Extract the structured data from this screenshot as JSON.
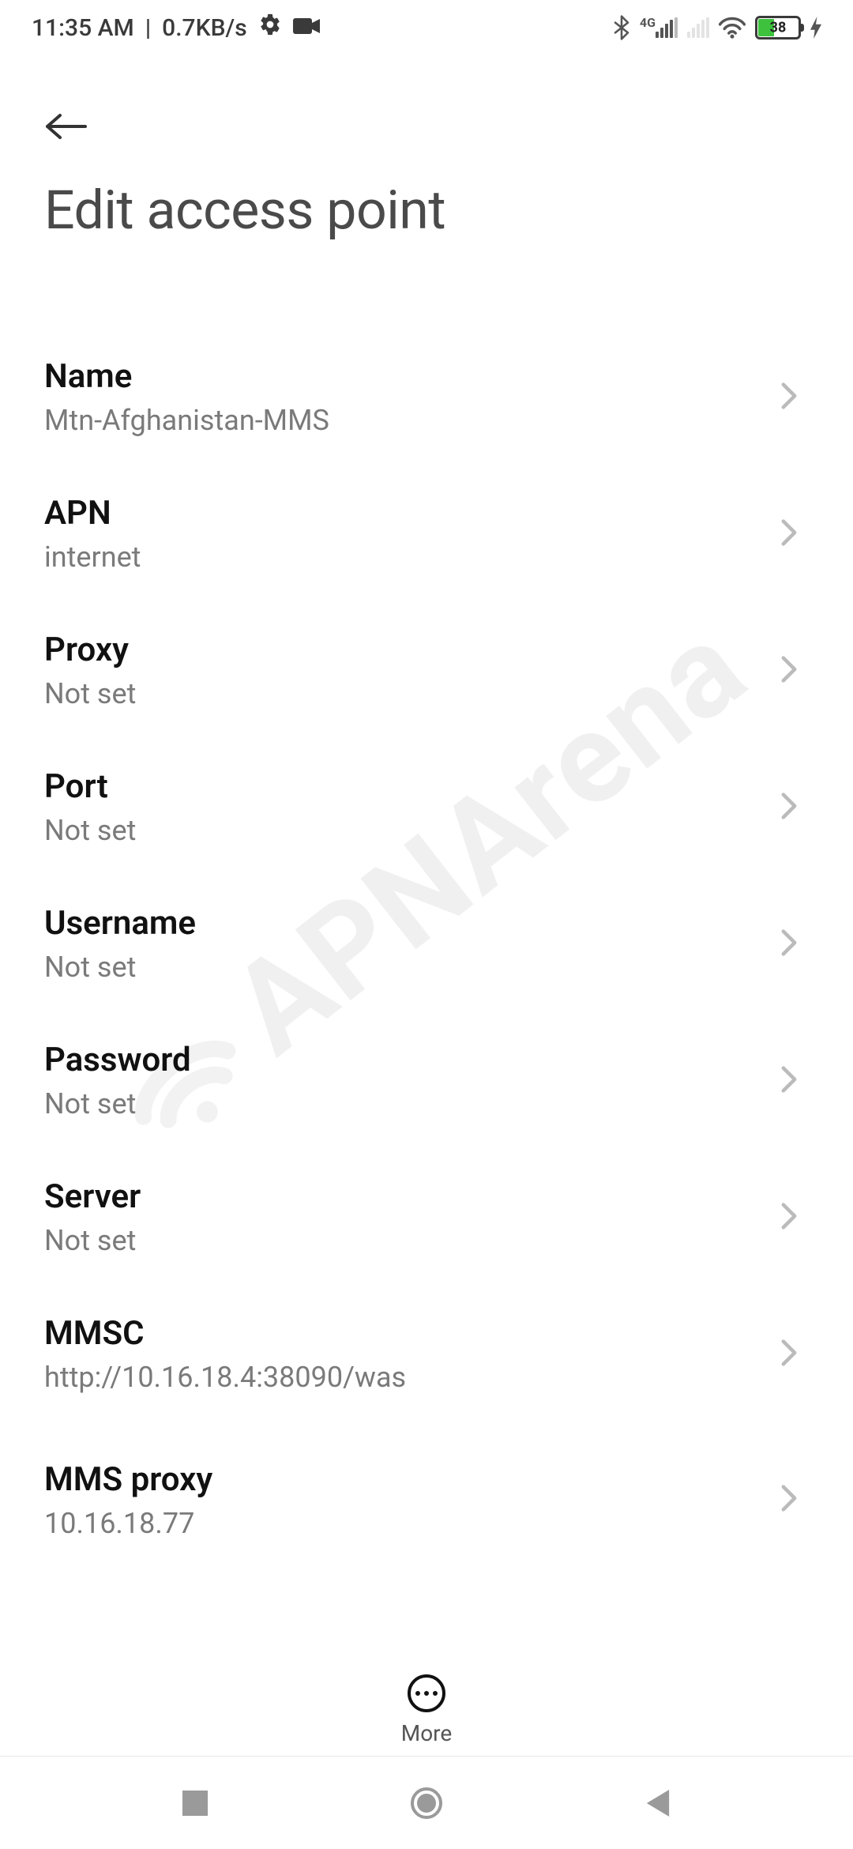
{
  "status": {
    "time": "11:35 AM",
    "speed": "0.7KB/s",
    "network_label": "4G",
    "battery_percent": "38"
  },
  "header": {
    "title": "Edit access point"
  },
  "rows": [
    {
      "label": "Name",
      "value": "Mtn-Afghanistan-MMS"
    },
    {
      "label": "APN",
      "value": "internet"
    },
    {
      "label": "Proxy",
      "value": "Not set"
    },
    {
      "label": "Port",
      "value": "Not set"
    },
    {
      "label": "Username",
      "value": "Not set"
    },
    {
      "label": "Password",
      "value": "Not set"
    },
    {
      "label": "Server",
      "value": "Not set"
    },
    {
      "label": "MMSC",
      "value": "http://10.16.18.4:38090/was"
    },
    {
      "label": "MMS proxy",
      "value": "10.16.18.77"
    }
  ],
  "bottom": {
    "more_label": "More"
  },
  "watermark_text": "APNArena"
}
